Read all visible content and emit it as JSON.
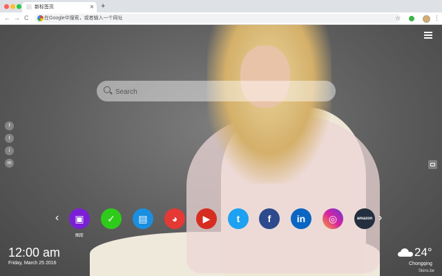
{
  "browser": {
    "tab_title": "新标签页",
    "tab_close": "×",
    "new_tab": "+",
    "omnibox_placeholder": "在Google中搜索，或者输入一个网址",
    "nav_back": "←",
    "nav_forward": "→",
    "nav_reload": "C",
    "bookmark_star": "☆",
    "menu_dots": "⋮"
  },
  "search": {
    "placeholder": "Search"
  },
  "social_icons": [
    "f",
    "t",
    "i",
    "m"
  ],
  "dock": {
    "items": [
      {
        "name": "gallery",
        "label": "图库",
        "glyph": "▣",
        "color": "#7b1fd6"
      },
      {
        "name": "tasks",
        "label": "",
        "glyph": "✓",
        "color": "#2fcb1a"
      },
      {
        "name": "notes",
        "label": "",
        "glyph": "▤",
        "color": "#1a8fe0"
      },
      {
        "name": "chrome-store",
        "label": "",
        "glyph": "◕",
        "color": "#e53935"
      },
      {
        "name": "youtube",
        "label": "",
        "glyph": "▶",
        "color": "#d62d20"
      },
      {
        "name": "twitter",
        "label": "",
        "glyph": "t",
        "color": "#1da1f2"
      },
      {
        "name": "facebook",
        "label": "",
        "glyph": "f",
        "color": "#2d4a8c"
      },
      {
        "name": "linkedin",
        "label": "",
        "glyph": "in",
        "color": "#0a66c2"
      },
      {
        "name": "instagram",
        "label": "",
        "glyph": "◎",
        "color": "#d6249f"
      },
      {
        "name": "amazon",
        "label": "",
        "glyph": "amazon",
        "color": "#232f3e"
      }
    ],
    "prev": "‹",
    "next": "›"
  },
  "clock": {
    "time": "12:00 am",
    "date": "Friday, March 25 2016"
  },
  "weather": {
    "temp": "24°",
    "city": "Chongqing"
  },
  "brand": "Skins.be"
}
